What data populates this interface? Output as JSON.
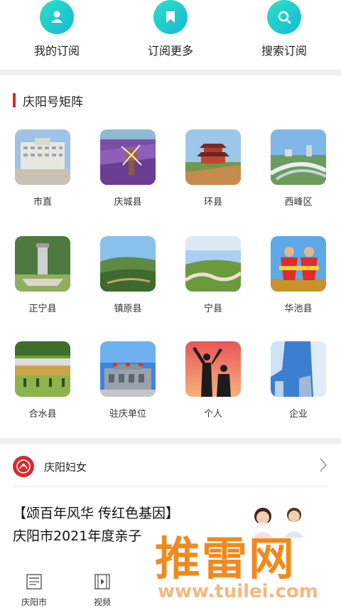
{
  "top_actions": [
    {
      "label": "我的订阅",
      "icon": "user-icon"
    },
    {
      "label": "订阅更多",
      "icon": "bookmark-icon"
    },
    {
      "label": "搜索订阅",
      "icon": "search-icon"
    }
  ],
  "matrix": {
    "title": "庆阳号矩阵",
    "accent": "#e0262d",
    "items": [
      {
        "label": "市直"
      },
      {
        "label": "庆城县"
      },
      {
        "label": "环县"
      },
      {
        "label": "西峰区"
      },
      {
        "label": "正宁县"
      },
      {
        "label": "镇原县"
      },
      {
        "label": "宁县"
      },
      {
        "label": "华池县"
      },
      {
        "label": "合水县"
      },
      {
        "label": "驻庆单位"
      },
      {
        "label": "个人"
      },
      {
        "label": "企业"
      }
    ]
  },
  "account": {
    "name": "庆阳妇女",
    "logo_color": "#d82a2f"
  },
  "article": {
    "title_line1": "【颂百年风华 传红色基因】",
    "title_line2": "庆阳市2021年度亲子"
  },
  "bottom_nav": [
    {
      "label": "庆阳市"
    },
    {
      "label": "视频"
    }
  ],
  "watermark": {
    "text": "推雷网",
    "url": "www.tuilei.com"
  }
}
